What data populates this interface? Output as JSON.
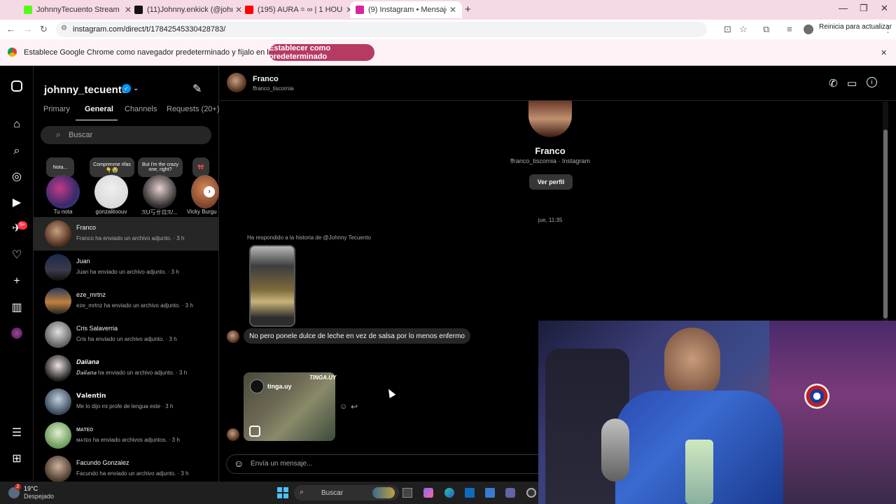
{
  "browser": {
    "tabs": [
      {
        "title": "JohnnyTecuento Stream - Watc",
        "favicon_color": "#53fc18"
      },
      {
        "title": "(11)Johnny.enkick (@johnny.en",
        "favicon_color": "#111111"
      },
      {
        "title": "(195) AURA = ∞ | 1 HOUR VIR",
        "favicon_color": "#ff0000"
      },
      {
        "title": "(9) Instagram • Mensajes",
        "favicon_color": "#d6249f"
      }
    ],
    "url": "instagram.com/direct/t/17842545330428783/",
    "restart_label": "Reinicia para actualizar",
    "infobar_text": "Establece Google Chrome como navegador predeterminado y fíjalo en la barra de tareas",
    "infobar_button": "Establecer como predeterminado"
  },
  "sidebar": {
    "username": "johnny_tecuento",
    "tabs": [
      "Primary",
      "General",
      "Channels",
      "Requests (20+)"
    ],
    "selected_tab": "General",
    "search_placeholder": "Buscar",
    "notes": [
      {
        "text": "Nota...",
        "name": "Tu nota"
      },
      {
        "text": "Comprenme rifas 👇😭",
        "name": "gonzalitoouv"
      },
      {
        "text": "But I'm the crazy one, right?",
        "name": "ℛᑌ丂卄ㄖℛ/..."
      },
      {
        "text": "🎀",
        "name": "Vicky Burgu"
      }
    ],
    "conversations": [
      {
        "name": "Franco",
        "preview": "Franco ha enviado un archivo adjunto. · 3 h"
      },
      {
        "name": "Juan",
        "preview": "Juan ha enviado un archivo adjunto. · 3 h"
      },
      {
        "name": "eze_mrtnz",
        "preview": "eze_mrtnz ha enviado un archivo adjunto. · 3 h"
      },
      {
        "name": "Cris Salaverria",
        "preview": "Cris ha enviado un archivo adjunto. · 3 h"
      },
      {
        "name": "𝑫𝒂𝒊𝒊𝒂𝒏𝒂",
        "preview": "𝑫𝒂𝒊𝒊𝒂𝒏𝒂 ha enviado un archivo adjunto. · 3 h"
      },
      {
        "name": "𝗩𝗮𝗹𝗲𝗻𝘁𝗶𝗻",
        "preview": "Me lo dijo mi profe de lengua este · 3 h"
      },
      {
        "name": "ᴍᴀᴛᴇᴏ",
        "preview": "ᴍᴀᴛᴇᴏ ha enviado archivos adjuntos. · 3 h"
      },
      {
        "name": "Facundo Gonzalez",
        "preview": "Facundo ha enviado un archivo adjunto. · 3 h"
      }
    ],
    "notification_badge": "9+"
  },
  "chat": {
    "name": "Franco",
    "handle": "ffranco_tiscornia",
    "profile_sub": "ffranco_tiscornia · Instagram",
    "view_profile": "Ver perfil",
    "timestamp": "jue, 11:35",
    "reply_label": "Ha respondido a la historia de @Johnny Tecuento",
    "message": "No pero ponele dulce de leche en vez de salsa por lo menos enfermo",
    "reel_account": "tinga.uy",
    "reel_watermark": "TINGA.UY",
    "composer_placeholder": "Envía un mensaje..."
  },
  "taskbar": {
    "temperature": "19°C",
    "condition": "Despejado",
    "search": "Buscar",
    "weather_badge": "2"
  }
}
